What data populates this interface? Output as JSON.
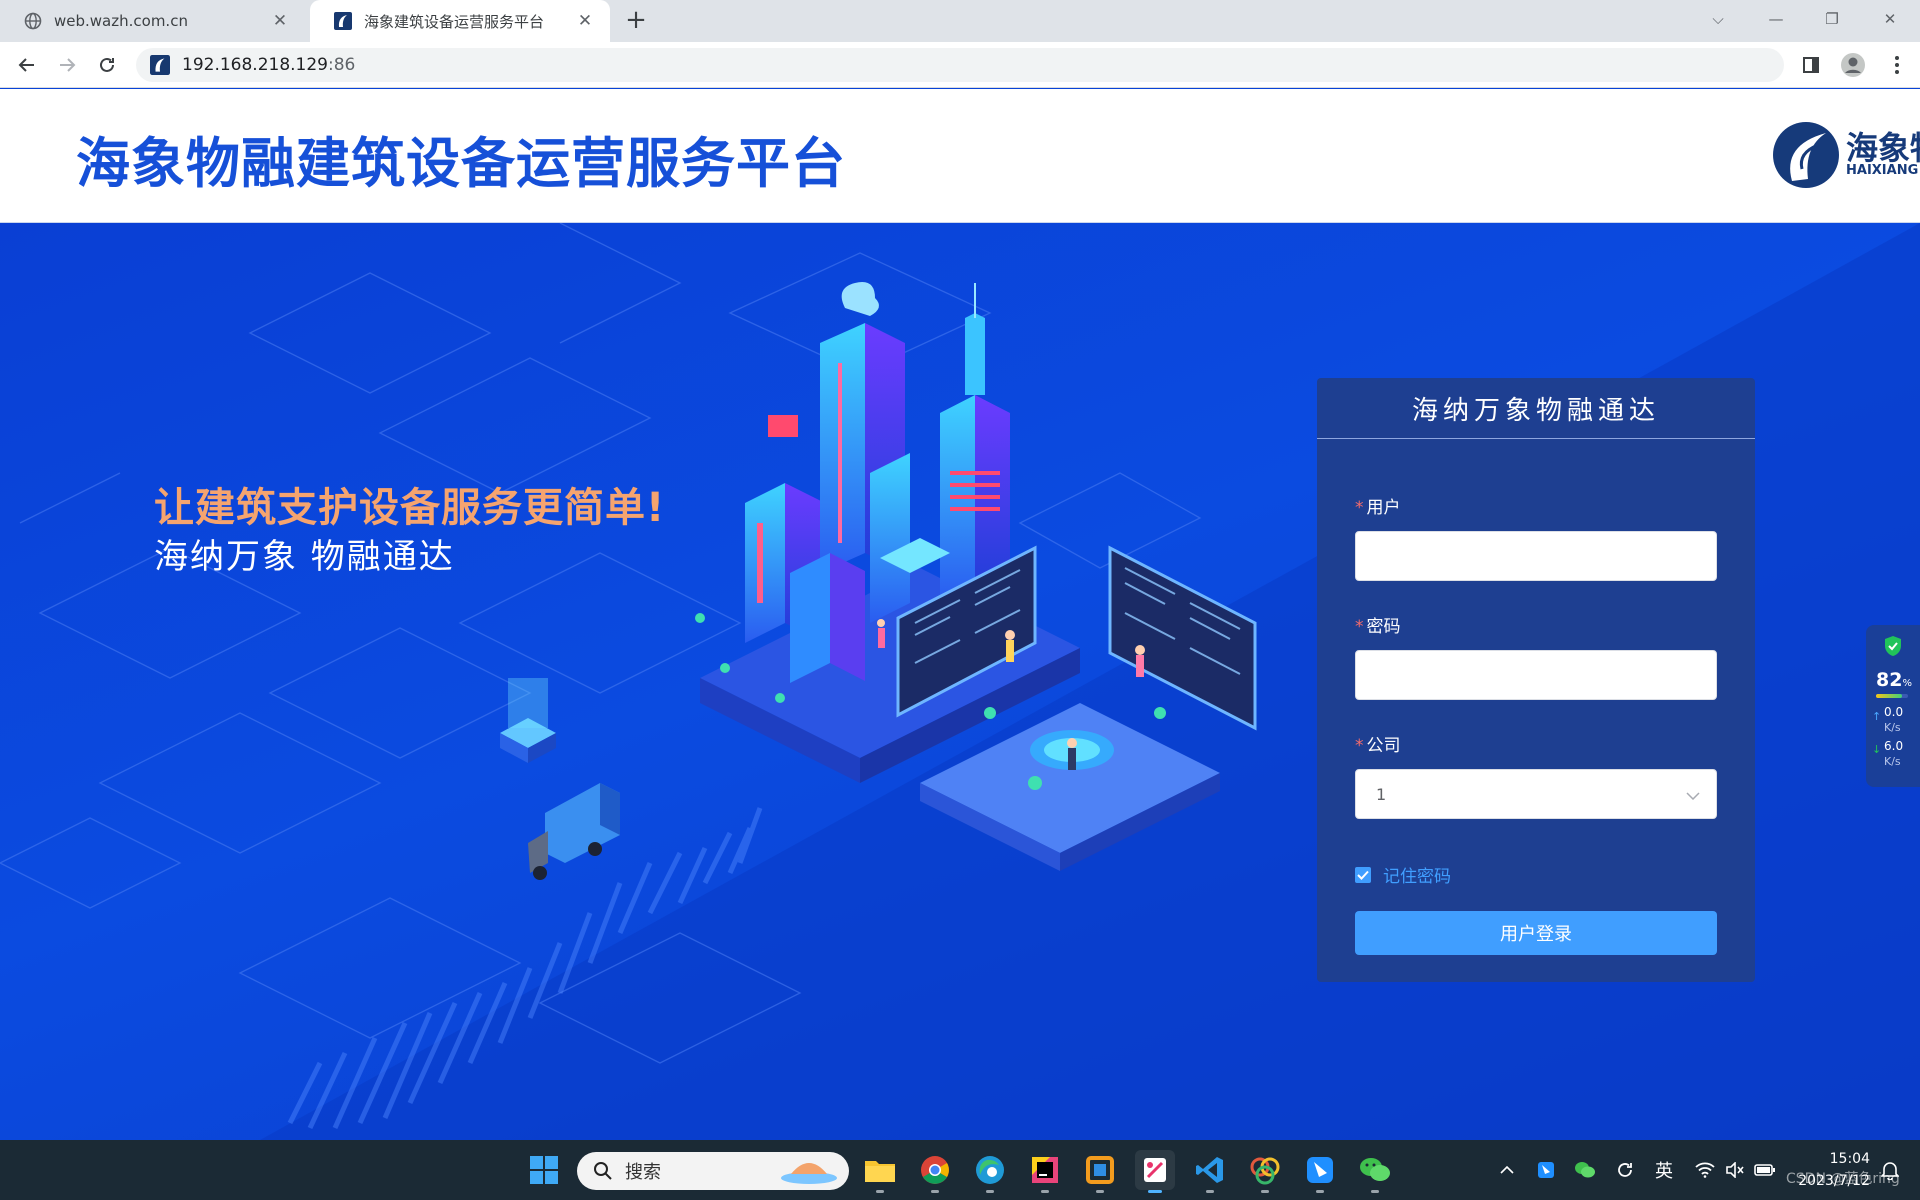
{
  "browser": {
    "tabs": [
      {
        "title": "web.wazh.com.cn",
        "active": false
      },
      {
        "title": "海象建筑设备运营服务平台",
        "active": true
      }
    ],
    "address": {
      "host": "192.168.218.129",
      "port": ":86"
    }
  },
  "header": {
    "title": "海象物融建筑设备运营服务平台",
    "brand_cn": "海象物",
    "brand_en": "HAIXIANG M"
  },
  "hero": {
    "slogan": "让建筑支护设备服务更简单!",
    "subslogan": "海纳万象 物融通达"
  },
  "login": {
    "title": "海纳万象物融通达",
    "required_mark": "*",
    "user_label": "用户",
    "user_value": "",
    "password_label": "密码",
    "password_value": "",
    "company_label": "公司",
    "company_value": "1",
    "remember_label": "记住密码",
    "remember_checked": true,
    "submit_label": "用户登录"
  },
  "netwidget": {
    "percent": "82",
    "percent_unit": "%",
    "percent_fraction": 0.82,
    "up": "0.0",
    "down": "6.0",
    "unit": "K/s"
  },
  "taskbar": {
    "search_placeholder": "搜索",
    "ime": "英",
    "time": "15:04",
    "date": "2023/7/12"
  },
  "watermark": "CSDN @蓝色ring",
  "colors": {
    "brand_blue": "#1650d8",
    "slogan_orange": "#f5a46f",
    "panel": "#1e3f91",
    "button": "#409eff",
    "required": "#f56c6c"
  }
}
